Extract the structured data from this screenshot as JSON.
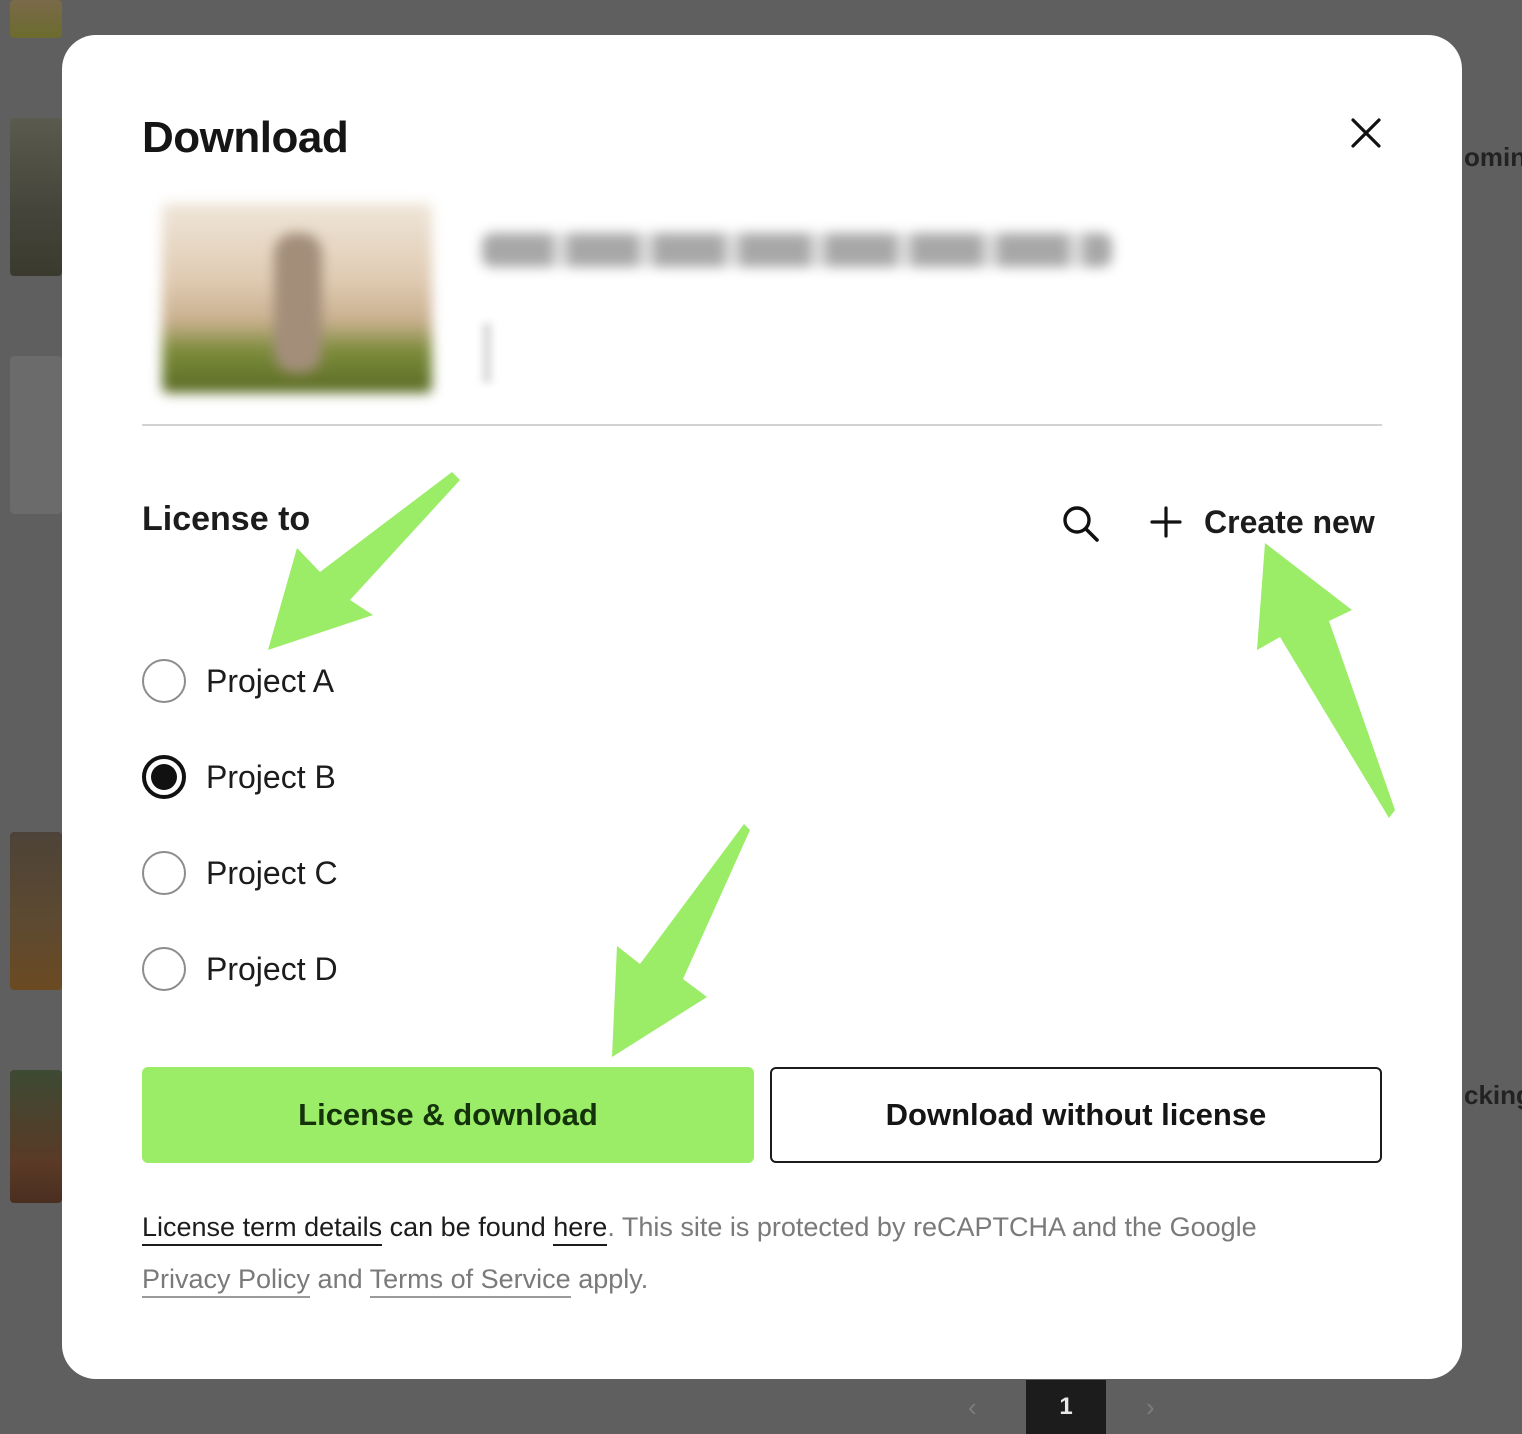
{
  "background": {
    "partial_text_1": "omin",
    "partial_text_2": "cking",
    "pagination": {
      "prev_icon": "chevron-left-icon",
      "current_page": "1",
      "next_icon": "chevron-right-icon"
    }
  },
  "modal": {
    "title": "Download",
    "close_icon": "close-icon",
    "license_section": {
      "label": "License to",
      "search_icon": "search-icon",
      "create_new_label": "Create new",
      "create_new_icon": "plus-icon",
      "projects": [
        {
          "label": "Project A",
          "selected": false
        },
        {
          "label": "Project B",
          "selected": true
        },
        {
          "label": "Project C",
          "selected": false
        },
        {
          "label": "Project D",
          "selected": false
        }
      ]
    },
    "buttons": {
      "primary_label": "License & download",
      "secondary_label": "Download without license"
    },
    "legal": {
      "license_terms_link": "License term details",
      "text_1": " can be found ",
      "here_link": "here",
      "text_2": ". This site is protected by reCAPTCHA and the Google ",
      "privacy_link": "Privacy Policy",
      "text_3": " and ",
      "terms_link": "Terms of Service",
      "text_4": " apply."
    }
  },
  "colors": {
    "accent_green": "#9bec66",
    "overlay": "#5f5f5f",
    "annotation_arrow": "#9bec66"
  }
}
